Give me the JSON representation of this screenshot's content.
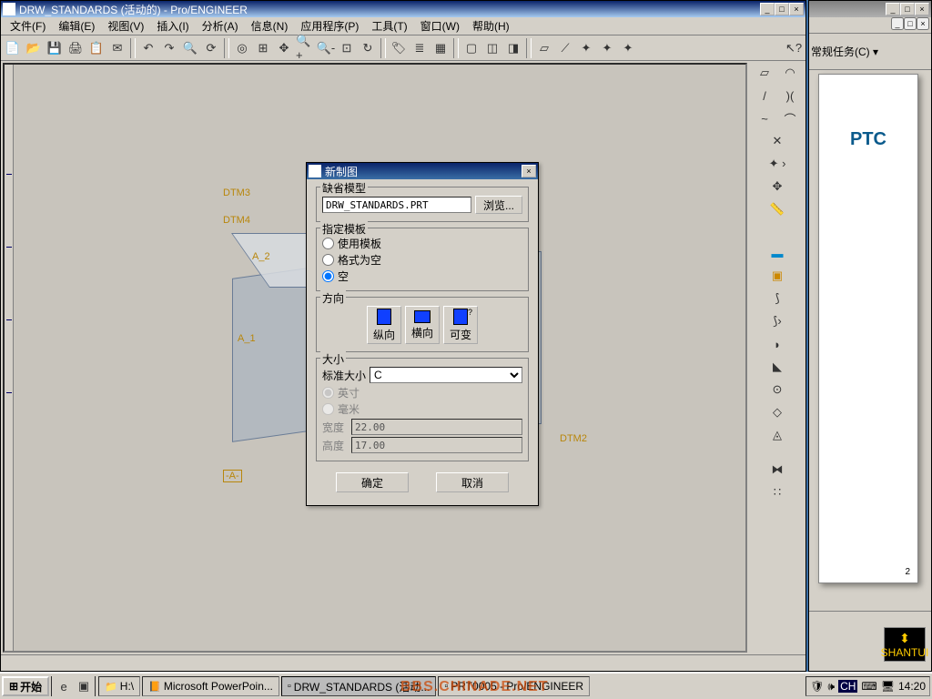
{
  "app": {
    "title": "DRW_STANDARDS (活动的) - Pro/ENGINEER",
    "menu": [
      "文件(F)",
      "编辑(E)",
      "视图(V)",
      "插入(I)",
      "分析(A)",
      "信息(N)",
      "应用程序(P)",
      "工具(T)",
      "窗口(W)",
      "帮助(H)"
    ]
  },
  "model_labels": {
    "dtm3": "DTM3",
    "dtm4": "DTM4",
    "dtm2": "DTM2",
    "a1": "A_1",
    "a2": "A_2",
    "a": "-A-"
  },
  "dialog": {
    "title": "新制图",
    "group_default_model": "缺省模型",
    "model_file": "DRW_STANDARDS.PRT",
    "browse": "浏览...",
    "group_template": "指定模板",
    "opt_use_template": "使用模板",
    "opt_format_empty": "格式为空",
    "opt_empty": "空",
    "group_orientation": "方向",
    "orient_portrait": "纵向",
    "orient_landscape": "横向",
    "orient_variable": "可变",
    "group_size": "大小",
    "std_size_label": "标准大小",
    "std_size_value": "C",
    "unit_inch": "英寸",
    "unit_mm": "毫米",
    "width_label": "宽度",
    "width_value": "22.00",
    "height_label": "高度",
    "height_value": "17.00",
    "ok": "确定",
    "cancel": "取消"
  },
  "right_panel": {
    "common_tasks": "常规任务(C) ▾",
    "ptc": "PTC",
    "shantui": "SHANTUI",
    "page_num": "2"
  },
  "taskbar": {
    "start": "开始",
    "drive": "H:\\",
    "ppt": "Microsoft PowerPoin...",
    "task_active": "DRW_STANDARDS (活动...",
    "task_proe": "PRT0005 - Pro/ENGINEER",
    "time": "14:20",
    "ime": "CH"
  },
  "watermark": "BBS.CHINADE.NET"
}
